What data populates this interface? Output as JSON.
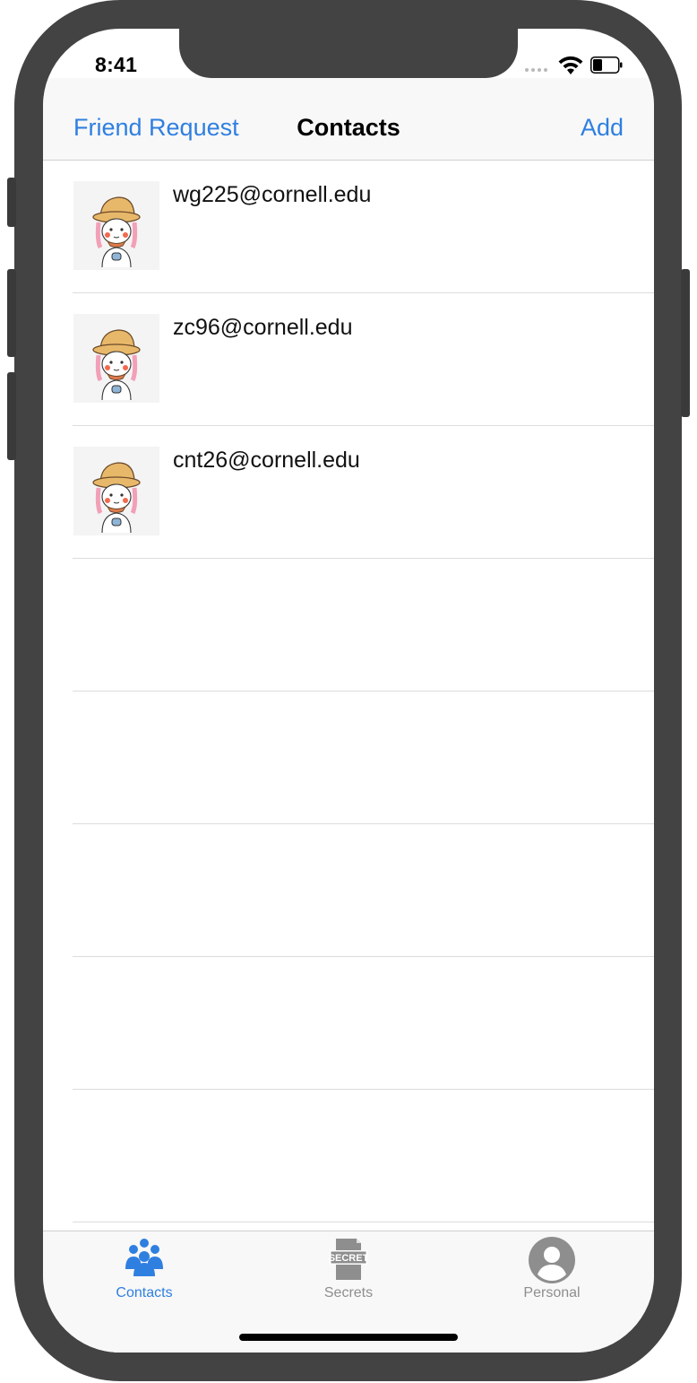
{
  "status_bar": {
    "time": "8:41"
  },
  "nav": {
    "left_label": "Friend Request",
    "title": "Contacts",
    "right_label": "Add"
  },
  "contacts": [
    {
      "email": "wg225@cornell.edu",
      "avatar": "girl-with-hat-avatar"
    },
    {
      "email": "zc96@cornell.edu",
      "avatar": "girl-with-hat-avatar"
    },
    {
      "email": "cnt26@cornell.edu",
      "avatar": "girl-with-hat-avatar"
    }
  ],
  "tabs": [
    {
      "label": "Contacts",
      "icon": "people-group-icon",
      "selected": true
    },
    {
      "label": "Secrets",
      "icon": "secret-document-icon",
      "selected": false,
      "icon_text": "SECRET"
    },
    {
      "label": "Personal",
      "icon": "person-circle-icon",
      "selected": false
    }
  ],
  "colors": {
    "accent": "#2f7fe0",
    "inactive": "#8e8e8e",
    "bezel": "#434343"
  }
}
